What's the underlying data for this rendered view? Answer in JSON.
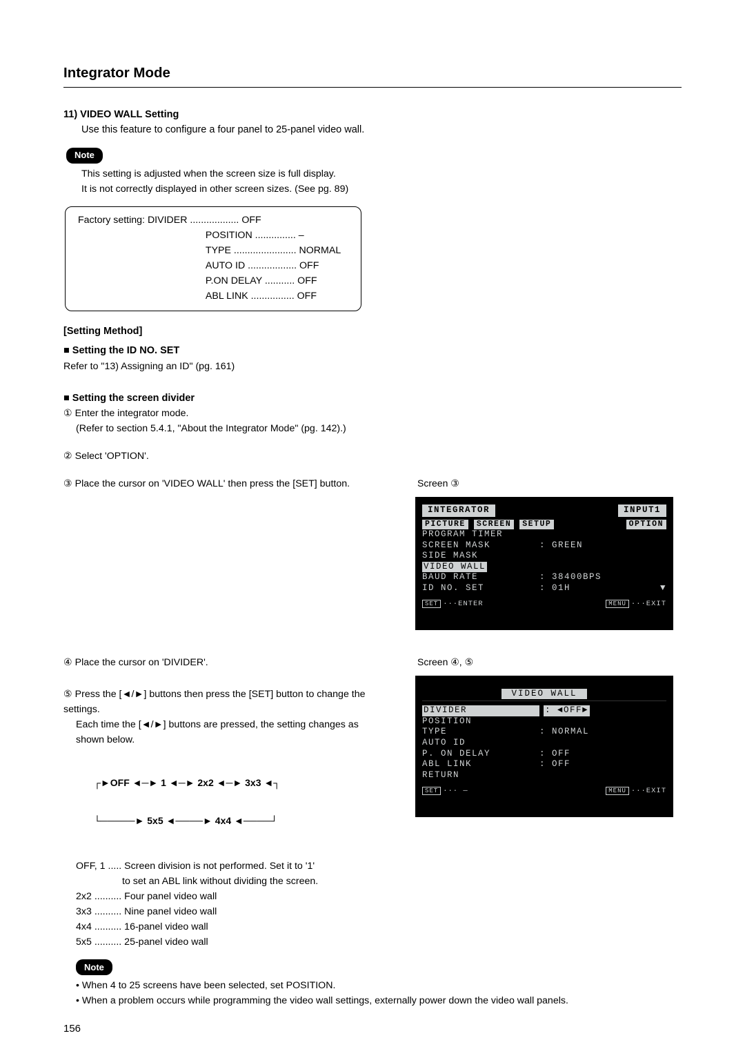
{
  "page_title": "Integrator Mode",
  "sec11": {
    "title": "11) VIDEO WALL Setting",
    "intro": "Use this feature to configure a four panel to 25-panel video wall."
  },
  "note_label": "Note",
  "note1_l1": "This setting is adjusted when the screen size is full display.",
  "note1_l2": "It is not correctly displayed in other screen sizes. (See pg. 89)",
  "factory": {
    "lead": "Factory setting: ",
    "r1": "DIVIDER .................. OFF",
    "r2": "POSITION ............... –",
    "r3": "TYPE ....................... NORMAL",
    "r4": "AUTO ID .................. OFF",
    "r5": "P.ON DELAY ........... OFF",
    "r6": "ABL LINK ................ OFF"
  },
  "setting_method": "[Setting Method]",
  "sub_id": "■ Setting the ID NO. SET",
  "sub_id_ref": "Refer to \"13) Assigning an ID\" (pg. 161)",
  "sub_div": "■ Setting the screen divider",
  "step1a": "① Enter the integrator mode.",
  "step1b": "(Refer to section 5.4.1, \"About the Integrator Mode\" (pg. 142).)",
  "step2": "② Select 'OPTION'.",
  "step3": "③ Place the cursor on 'VIDEO WALL' then press the [SET] button.",
  "screen3_label": "Screen ③",
  "osd1": {
    "integrator": "INTEGRATOR",
    "input": "INPUT1",
    "tab_picture": "PICTURE",
    "tab_screen": "SCREEN",
    "tab_setup": "SETUP",
    "tab_option": "OPTION",
    "l1": "PROGRAM TIMER",
    "l2_lbl": "SCREEN MASK",
    "l2_val": ": GREEN",
    "l3": "SIDE MASK",
    "l4": "VIDEO WALL",
    "l5_lbl": "BAUD RATE",
    "l5_val": ": 38400BPS",
    "l6_lbl": "ID NO. SET",
    "l6_val": ": 01H",
    "foot_enter_key": "SET",
    "foot_enter": "···ENTER",
    "foot_menu_key": "MENU",
    "foot_exit": "···EXIT"
  },
  "step4": "④ Place the cursor on 'DIVIDER'.",
  "screen45_label": "Screen ④, ⑤",
  "step5a": "⑤ Press the [◄/►] buttons then press the [SET] button to change the settings.",
  "step5b": "Each time the [◄/►] buttons are pressed, the setting changes as shown below.",
  "osd2": {
    "title": "VIDEO WALL",
    "r1_lbl": "DIVIDER",
    "r1_val": ": ◄OFF►",
    "r2": "POSITION",
    "r3_lbl": "TYPE",
    "r3_val": ": NORMAL",
    "r4": "AUTO ID",
    "r5_lbl": "P. ON DELAY",
    "r5_val": ": OFF",
    "r6_lbl": "ABL LINK",
    "r6_val": ": OFF",
    "r7": " RETURN",
    "foot_set_key": "SET",
    "foot_set": "··· —",
    "foot_menu_key": "MENU",
    "foot_exit": "···EXIT"
  },
  "arrows": {
    "l1": "┌►OFF ◄─► 1 ◄─► 2x2 ◄─► 3x3 ◄┐",
    "l2": "└─────► 5x5 ◄────► 4x4 ◄────┘"
  },
  "defs": {
    "d1": "OFF, 1 ..... Screen division is not performed. Set it to '1'",
    "d1b": "                 to set an ABL link without dividing the screen.",
    "d2": "2x2 .......... Four panel video wall",
    "d3": "3x3 .......... Nine panel video wall",
    "d4": "4x4 .......... 16-panel video wall",
    "d5": "5x5 .......... 25-panel video wall"
  },
  "note2": {
    "b1": "• When 4 to 25 screens have been selected, set POSITION.",
    "b2": "• When a problem occurs while programming the video wall settings, externally power down the video wall panels."
  },
  "page_no": "156"
}
